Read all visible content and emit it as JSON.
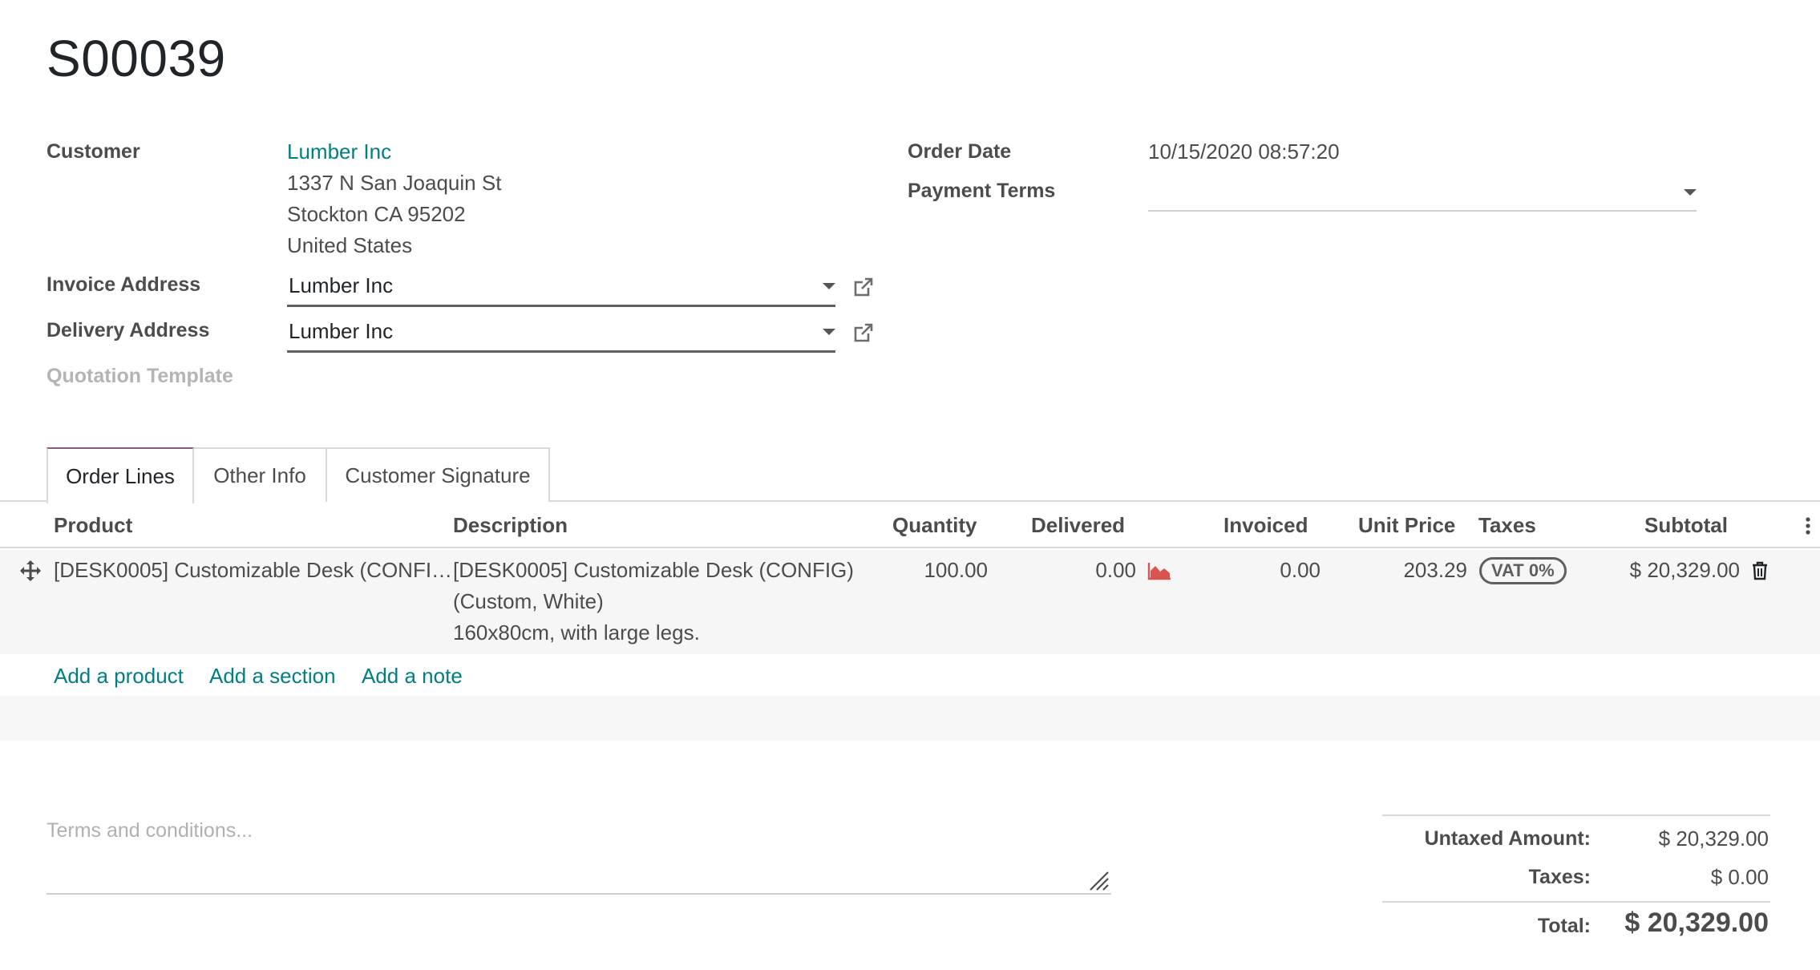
{
  "order": {
    "title": "S00039"
  },
  "customer": {
    "label": "Customer",
    "name": "Lumber Inc",
    "address_line1": "1337 N San Joaquin St",
    "address_line2": "Stockton CA 95202",
    "address_line3": "United States"
  },
  "invoice_address": {
    "label": "Invoice Address",
    "value": "Lumber Inc"
  },
  "delivery_address": {
    "label": "Delivery Address",
    "value": "Lumber Inc"
  },
  "quotation_template": {
    "label": "Quotation Template"
  },
  "order_date": {
    "label": "Order Date",
    "value": "10/15/2020 08:57:20"
  },
  "payment_terms": {
    "label": "Payment Terms",
    "value": ""
  },
  "tabs": [
    {
      "label": "Order Lines",
      "active": true
    },
    {
      "label": "Other Info",
      "active": false
    },
    {
      "label": "Customer Signature",
      "active": false
    }
  ],
  "table": {
    "headers": {
      "product": "Product",
      "description": "Description",
      "quantity": "Quantity",
      "delivered": "Delivered",
      "invoiced": "Invoiced",
      "unit_price": "Unit Price",
      "taxes": "Taxes",
      "subtotal": "Subtotal"
    },
    "rows": [
      {
        "product": "[DESK0005] Customizable Desk (CONFI…",
        "description_line1": "[DESK0005] Customizable Desk (CONFIG)",
        "description_line2": "(Custom, White)",
        "description_line3": "160x80cm, with large legs.",
        "quantity": "100.00",
        "delivered": "0.00",
        "invoiced": "0.00",
        "unit_price": "203.29",
        "tax": "VAT 0%",
        "subtotal": "$ 20,329.00"
      }
    ]
  },
  "actions": {
    "add_product": "Add a product",
    "add_section": "Add a section",
    "add_note": "Add a note"
  },
  "terms": {
    "placeholder": "Terms and conditions..."
  },
  "totals": {
    "untaxed_label": "Untaxed Amount:",
    "untaxed_value": "$ 20,329.00",
    "taxes_label": "Taxes:",
    "taxes_value": "$ 0.00",
    "total_label": "Total:",
    "total_value": "$ 20,329.00"
  },
  "icons": {
    "drag_handle": "drag-handle-icon",
    "external_link": "external-link-icon",
    "forecast_chart": "area-chart-icon",
    "delete": "trash-icon",
    "column_options": "kebab-menu-icon",
    "resize": "resize-grip-icon"
  },
  "colors": {
    "link": "#017e84",
    "tab_accent": "#875a7b",
    "chart_icon": "#d9534f"
  }
}
